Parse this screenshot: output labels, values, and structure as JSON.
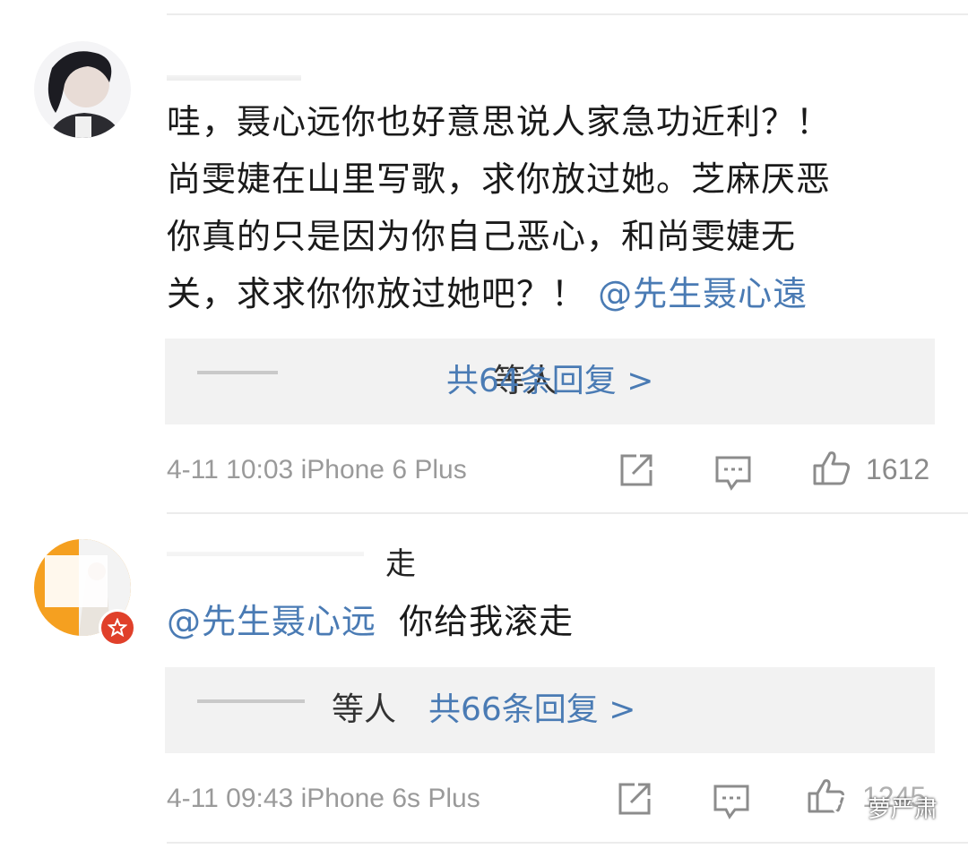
{
  "comments": [
    {
      "username_visible": "",
      "text_parts": [
        {
          "text": "哇，聂心远你也好意思说人家急功近利？！尚雯婕在山里写歌，求你放过她。芝麻厌恶你真的只是因为你自己恶心，和尚雯婕无关，求求你你放过她吧？！ ",
          "mention": false
        },
        {
          "text": "@先生聂心遠",
          "mention": true
        }
      ],
      "lines": [
        "哇，聂心远你也好意思说人家急功近利？！",
        "尚雯婕在山里写歌，求你放过她。芝麻厌恶",
        "你真的只是因为你自己恶心，和尚雯婕无",
        "关，求求你你放过她吧？！"
      ],
      "line4_mention": "@先生聂心遠",
      "replies_names_suffix": "等人",
      "replies_link": "共64条回复 >",
      "timestamp": "4-11 10:03",
      "device": "iPhone 6 Plus",
      "likes": "1612",
      "share_icon": "share-icon",
      "comment_icon": "comment-icon",
      "like_icon": "thumbs-up-icon"
    },
    {
      "username_visible": "走",
      "mention": "@先生聂心远",
      "text": "你给我滚走",
      "replies_names_suffix": "等人",
      "replies_link": "共66条回复 >",
      "timestamp": "4-11 09:43",
      "device": "iPhone 6s Plus",
      "likes": "1245",
      "share_icon": "share-icon",
      "comment_icon": "comment-icon",
      "like_icon": "thumbs-up-icon",
      "badge_icon": "verified-star-icon"
    }
  ],
  "watermark": {
    "text": "萝严肃",
    "icon": "wechat-icon"
  },
  "colors": {
    "link": "#4a7bb4",
    "meta": "#9a9a9a",
    "reply_bg": "#f2f2f2",
    "badge": "#e0402a"
  }
}
